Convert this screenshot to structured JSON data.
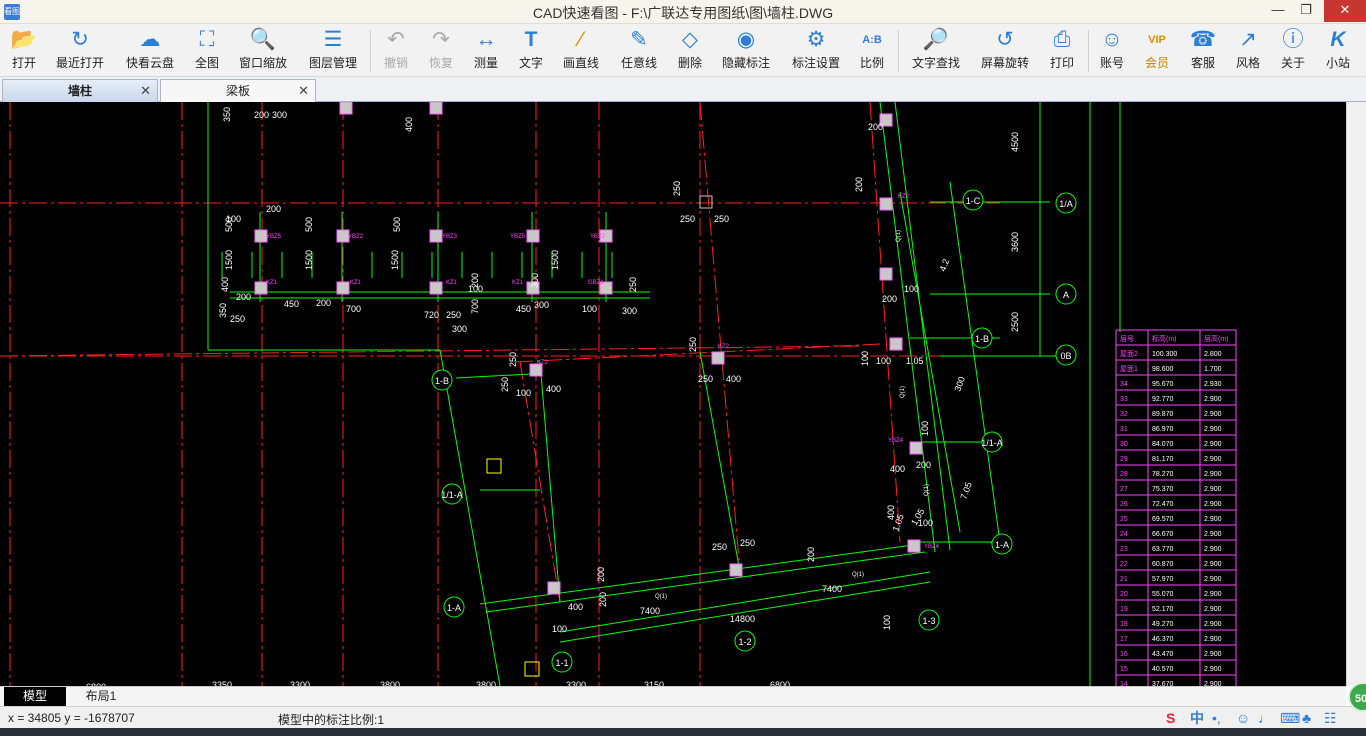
{
  "window": {
    "title": "CAD快速看图 - F:\\广联达专用图纸\\图\\墙柱.DWG",
    "app_icon_text": "看图",
    "minimize": "—",
    "maximize": "❐",
    "close": "✕"
  },
  "toolbar": {
    "open": "打开",
    "recent": "最近打开",
    "cloud": "快看云盘",
    "fit": "全图",
    "zoom_window": "窗口缩放",
    "layers": "图层管理",
    "undo": "撤销",
    "redo": "恢复",
    "measure": "测量",
    "text": "文字",
    "line": "画直线",
    "freeline": "任意线",
    "erase": "删除",
    "hide_dim": "隐藏标注",
    "dim_settings": "标注设置",
    "scale": "比例",
    "text_search": "文字查找",
    "rotate": "屏幕旋转",
    "print": "打印",
    "account": "账号",
    "vip": "会员",
    "service": "客服",
    "style": "风格",
    "about": "关于",
    "site": "小站",
    "icons": {
      "open": "folder-open-icon",
      "recent": "clock-icon",
      "cloud": "cloud-icon",
      "fit": "fit-view-icon",
      "zoom_window": "zoom-window-icon",
      "layers": "layers-icon",
      "undo": "undo-icon",
      "redo": "redo-icon",
      "measure": "ruler-icon",
      "text": "text-t-icon",
      "line": "line-icon",
      "freeline": "pencil-icon",
      "erase": "eraser-icon",
      "hide_dim": "eye-hidden-icon",
      "dim_settings": "dimension-settings-icon",
      "scale": "scale-ab-icon",
      "text_search": "text-search-icon",
      "rotate": "screen-rotate-icon",
      "print": "printer-icon",
      "account": "user-icon",
      "vip": "vip-icon",
      "service": "headset-icon",
      "style": "style-icon",
      "about": "info-icon",
      "site": "k-logo-icon"
    },
    "vip_badge": "VIP",
    "scale_badge": "A:B",
    "site_glyph": "K"
  },
  "tabs": [
    {
      "label": "墙柱",
      "active": true,
      "close": "✕"
    },
    {
      "label": "梁板",
      "active": false,
      "close": "✕"
    }
  ],
  "drawing": {
    "axis_labels": [
      "1-C",
      "1/A",
      "A",
      "1-B",
      "0B",
      "1-B",
      "1/1-A",
      "1/1-A",
      "1-A",
      "1-A",
      "1-1",
      "1-2",
      "1-3"
    ],
    "top_dims": [
      "350",
      "200",
      "300",
      "400",
      "4500",
      "250",
      "250",
      "250",
      "200",
      "200",
      "4.2",
      "3600",
      "100",
      "200",
      "2500"
    ],
    "row_dims": [
      "100",
      "200",
      "500",
      "500",
      "500",
      "1500",
      "1500",
      "1500",
      "1500",
      "200",
      "100",
      "300",
      "400",
      "200",
      "350",
      "250",
      "450",
      "200",
      "700",
      "720",
      "250",
      "300",
      "700",
      "450",
      "300",
      "100",
      "300",
      "250"
    ],
    "mid_dims": [
      "250",
      "250",
      "400",
      "100",
      "250",
      "250",
      "400",
      "100",
      "100",
      "1.05",
      "300",
      "100",
      "200",
      "400",
      "100",
      "1.05",
      "100",
      "400",
      "250",
      "250",
      "200",
      "200",
      "200",
      "7400",
      "7400",
      "14800",
      "400",
      "100",
      "1.05",
      "7.05"
    ],
    "bottom_dims": [
      "6800",
      "3350",
      "3300",
      "3800",
      "3800",
      "3300",
      "3150",
      "6800"
    ],
    "column_tags": [
      "YBZ5",
      "YBZ2",
      "YBZ3",
      "YBZ5",
      "YBZ2",
      "KZ1",
      "KZ1",
      "KZ1",
      "KZ1",
      "GBZ1",
      "KZ2",
      "KZ2",
      "KZ2",
      "YBZ4",
      "YBZ4"
    ],
    "wall_tags": [
      "Q(1)",
      "Q(1)",
      "Q(1)",
      "Q(1)",
      "Q(1)"
    ],
    "table": {
      "headers": [
        "层号",
        "标高(m)",
        "层高(m)"
      ],
      "rows": [
        [
          "屋面2",
          "100.300",
          "2.800"
        ],
        [
          "屋面1",
          "98.600",
          "1.700"
        ],
        [
          "34",
          "95.670",
          "2.930"
        ],
        [
          "33",
          "92.770",
          "2.900"
        ],
        [
          "32",
          "89.870",
          "2.900"
        ],
        [
          "31",
          "86.970",
          "2.900"
        ],
        [
          "30",
          "84.070",
          "2.900"
        ],
        [
          "29",
          "81.170",
          "2.900"
        ],
        [
          "28",
          "78.270",
          "2.900"
        ],
        [
          "27",
          "75.370",
          "2.900"
        ],
        [
          "26",
          "72.470",
          "2.900"
        ],
        [
          "25",
          "69.570",
          "2.900"
        ],
        [
          "24",
          "66.670",
          "2.900"
        ],
        [
          "23",
          "63.770",
          "2.900"
        ],
        [
          "22",
          "60.870",
          "2.900"
        ],
        [
          "21",
          "57.970",
          "2.900"
        ],
        [
          "20",
          "55.070",
          "2.900"
        ],
        [
          "19",
          "52.170",
          "2.900"
        ],
        [
          "18",
          "49.270",
          "2.900"
        ],
        [
          "17",
          "46.370",
          "2.900"
        ],
        [
          "16",
          "43.470",
          "2.900"
        ],
        [
          "15",
          "40.570",
          "2.900"
        ],
        [
          "14",
          "37.670",
          "2.900"
        ]
      ]
    }
  },
  "layout_tabs": [
    {
      "label": "模型",
      "active": true
    },
    {
      "label": "布局1",
      "active": false
    }
  ],
  "status": {
    "coords": "x = 34805  y = -1678707",
    "scale_note": "模型中的标注比例:1",
    "ime": "中",
    "badge": "50"
  },
  "colors": {
    "canvas": "#000000",
    "axis": "#ff2020",
    "wall": "#00ff00",
    "dim_text": "#ffffff",
    "tag": "#ff40ff",
    "table_line": "#ff40ff",
    "column": "#c8c8c8",
    "accent": "#2c7fd6"
  }
}
